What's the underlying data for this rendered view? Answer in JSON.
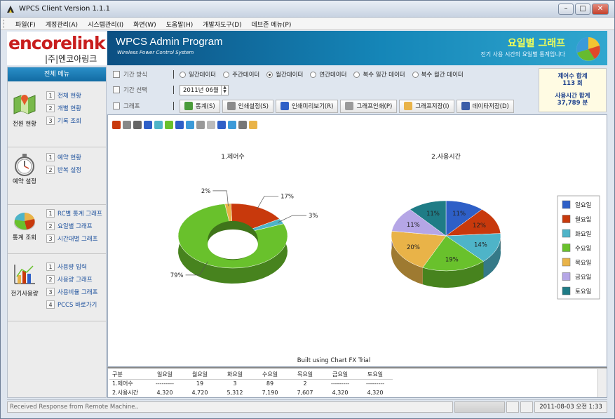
{
  "window": {
    "title": "WPCS Client Version 1.1.1"
  },
  "menu": [
    "파일(F)",
    "계정관리(A)",
    "시스템관리(I)",
    "화면(W)",
    "도움말(H)",
    "개발자도구(D)",
    "데브존 메뉴(P)"
  ],
  "logo": {
    "brand": "encorelink",
    "sub": "|주|엔코아링크"
  },
  "banner": {
    "title": "WPCS Admin Program",
    "subtitle": "Wireless Power Control System",
    "right_title": "요일별 그래프",
    "right_sub": "전기 사용 시간의 요일별 통계입니다"
  },
  "sidebar": {
    "header": "전체 메뉴",
    "groups": [
      {
        "label": "전원 현황",
        "icon": "map-icon",
        "items": [
          {
            "num": "1",
            "label": "전체 현황"
          },
          {
            "num": "2",
            "label": "개별 현황"
          },
          {
            "num": "3",
            "label": "기록 조회"
          }
        ]
      },
      {
        "label": "예약 설정",
        "icon": "stopwatch-icon",
        "items": [
          {
            "num": "1",
            "label": "예약 현황"
          },
          {
            "num": "2",
            "label": "반복 설정"
          }
        ]
      },
      {
        "label": "통계 조회",
        "icon": "pie-chart-icon",
        "items": [
          {
            "num": "1",
            "label": "RC별 통계 그래프"
          },
          {
            "num": "2",
            "label": "요일별 그래프"
          },
          {
            "num": "3",
            "label": "시간대별 그래프"
          }
        ]
      },
      {
        "label": "전기사용량",
        "icon": "bar-chart-icon",
        "items": [
          {
            "num": "1",
            "label": "사용량 입력"
          },
          {
            "num": "2",
            "label": "사용량 그래프"
          },
          {
            "num": "3",
            "label": "사용비율 그래프"
          },
          {
            "num": "4",
            "label": "PCCS 바로가기"
          }
        ]
      }
    ]
  },
  "options": {
    "method_label": "기간 방식",
    "method_options": [
      {
        "label": "일간데이터",
        "selected": false
      },
      {
        "label": "주간데이터",
        "selected": false
      },
      {
        "label": "월간데이터",
        "selected": true
      },
      {
        "label": "연간데이터",
        "selected": false
      },
      {
        "label": "복수 일간 데이터",
        "selected": false
      },
      {
        "label": "복수 월간 데이터",
        "selected": false
      }
    ],
    "period_label": "기간 선택",
    "period_value": "2011년 06월",
    "graph_label": "그래프",
    "graph_buttons": [
      "통계(S)",
      "인쇄설정(S)",
      "인쇄미리보기(R)",
      "그래프인쇄(P)",
      "그래프저장(I)",
      "데이타저장(D)"
    ]
  },
  "summary": {
    "count_label": "제어수 합계",
    "count_value": "113 회",
    "time_label": "사용시간 합계",
    "time_value": "37,789 분"
  },
  "chart_footer": "Built using Chart FX Trial",
  "chart_data": [
    {
      "type": "pie",
      "title": "1.제어수",
      "categories": [
        "일요일",
        "월요일",
        "화요일",
        "수요일",
        "목요일",
        "금요일",
        "토요일"
      ],
      "values": [
        0,
        19,
        3,
        89,
        2,
        0,
        0
      ],
      "labels": [
        "",
        "17%",
        "3%",
        "79%",
        "2%",
        "",
        ""
      ]
    },
    {
      "type": "pie",
      "title": "2.사용시간",
      "categories": [
        "일요일",
        "월요일",
        "화요일",
        "수요일",
        "목요일",
        "금요일",
        "토요일"
      ],
      "values": [
        4320,
        4720,
        5312,
        7190,
        7607,
        4320,
        4320
      ],
      "labels": [
        "11%",
        "12%",
        "14%",
        "19%",
        "20%",
        "11%",
        "11%"
      ]
    }
  ],
  "legend": {
    "placement": "right",
    "items": [
      {
        "label": "일요일",
        "color": "#2e5fc7"
      },
      {
        "label": "월요일",
        "color": "#c8390c"
      },
      {
        "label": "화요일",
        "color": "#4eb4c8"
      },
      {
        "label": "수요일",
        "color": "#69c12c"
      },
      {
        "label": "목요일",
        "color": "#e9b348"
      },
      {
        "label": "금요일",
        "color": "#b5a6e6"
      },
      {
        "label": "토요일",
        "color": "#1f7c86"
      }
    ]
  },
  "table": {
    "headers": [
      "구분",
      "일요일",
      "월요일",
      "화요일",
      "수요일",
      "목요일",
      "금요일",
      "토요일"
    ],
    "rows": [
      [
        "1.제어수",
        "---------",
        "19",
        "3",
        "89",
        "2",
        "---------",
        "---------"
      ],
      [
        "2.사용시간",
        "4,320",
        "4,720",
        "5,312",
        "7,190",
        "7,607",
        "4,320",
        "4,320"
      ]
    ]
  },
  "status": {
    "text": "Received Response from Remote Machine..",
    "clock": "2011-08-03 오전 1:33"
  }
}
